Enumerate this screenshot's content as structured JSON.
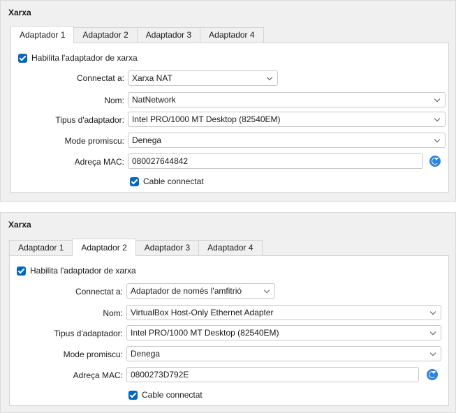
{
  "panels": [
    {
      "title": "Xarxa",
      "tabs": [
        "Adaptador 1",
        "Adaptador 2",
        "Adaptador 3",
        "Adaptador 4"
      ],
      "active_tab": "Adaptador 1",
      "enable_label": "Habilita l'adaptador de xarxa",
      "enabled": true,
      "attached_label": "Connectat a:",
      "attached_value": "Xarxa NAT",
      "name_label": "Nom:",
      "name_value": "NatNetwork",
      "adapter_type_label": "Tipus d'adaptador:",
      "adapter_type_value": "Intel PRO/1000 MT Desktop (82540EM)",
      "promisc_label": "Mode promiscu:",
      "promisc_value": "Denega",
      "mac_label": "Adreça MAC:",
      "mac_value": "080027644842",
      "cable_label": "Cable connectat",
      "cable_connected": true
    },
    {
      "title": "Xarxa",
      "tabs": [
        "Adaptador 1",
        "Adaptador 2",
        "Adaptador 3",
        "Adaptador 4"
      ],
      "active_tab": "Adaptador 2",
      "enable_label": "Habilita l'adaptador de xarxa",
      "enabled": true,
      "attached_label": "Connectat a:",
      "attached_value": "Adaptador de només l'amfitrió",
      "name_label": "Nom:",
      "name_value": "VirtualBox Host-Only Ethernet Adapter",
      "adapter_type_label": "Tipus d'adaptador:",
      "adapter_type_value": "Intel PRO/1000 MT Desktop (82540EM)",
      "promisc_label": "Mode promiscu:",
      "promisc_value": "Denega",
      "mac_label": "Adreça MAC:",
      "mac_value": "0800273D792E",
      "cable_label": "Cable connectat",
      "cable_connected": true
    }
  ],
  "icons": {
    "refresh": "refresh-mac-icon",
    "checkbox": "checkbox-checked-icon",
    "dropdown": "chevron-down-icon"
  },
  "colors": {
    "accent": "#0067c0",
    "panel_bg": "#f0f0f0"
  }
}
